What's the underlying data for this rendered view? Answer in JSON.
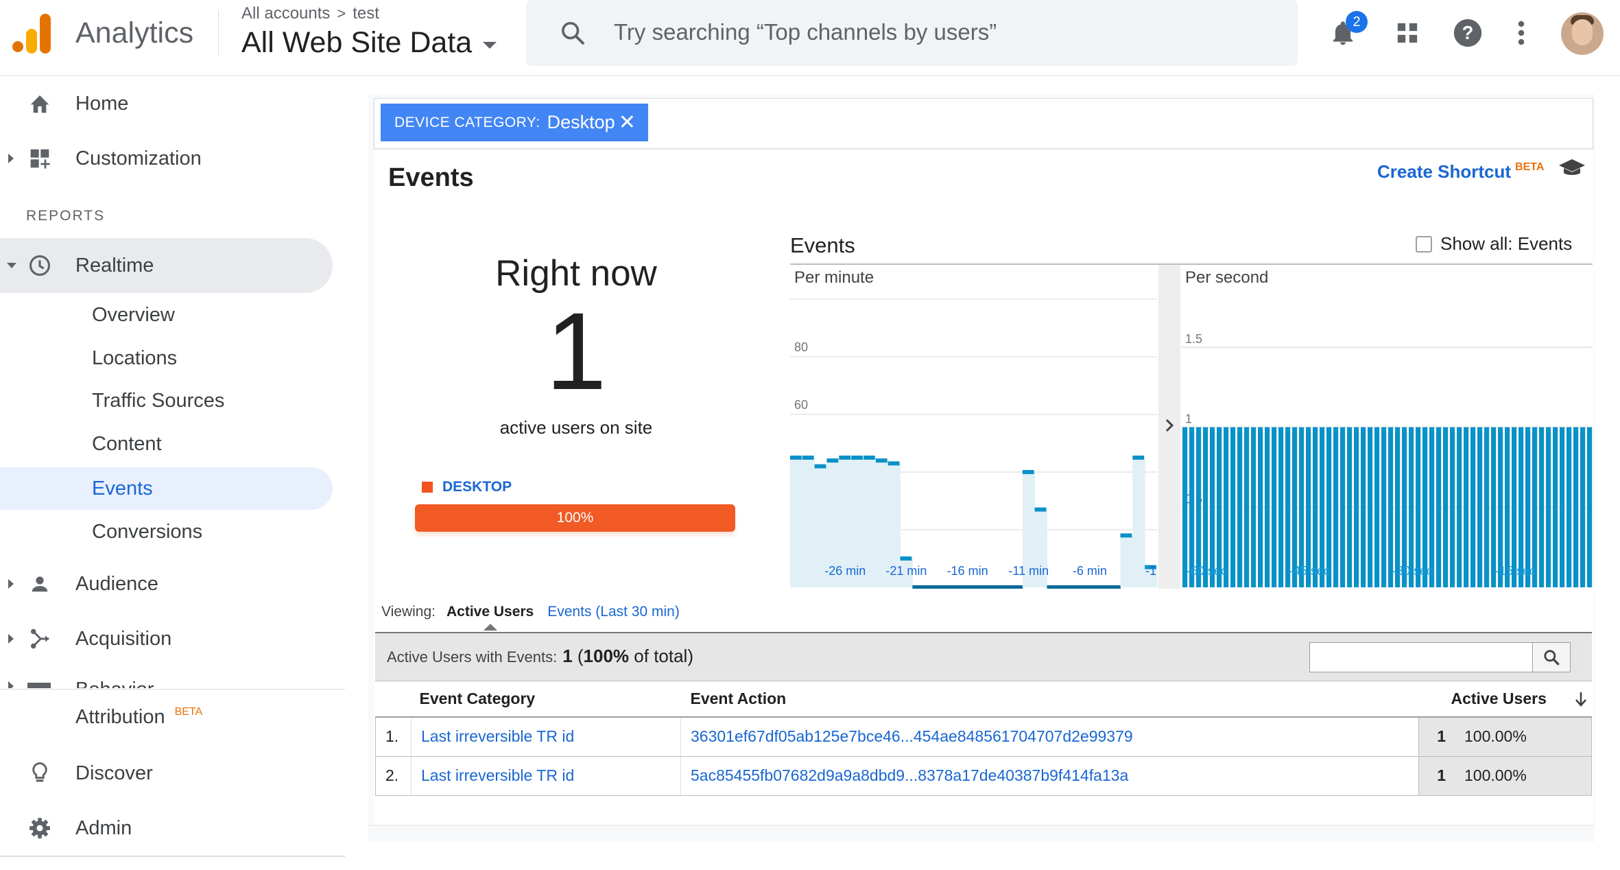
{
  "header": {
    "app_name": "Analytics",
    "breadcrumb": {
      "account": "All accounts",
      "separator": ">",
      "property": "test"
    },
    "view_name": "All Web Site Data",
    "search_placeholder": "Try searching “Top channels by users”",
    "notification_count": "2",
    "icons": [
      "search-icon",
      "bell-icon",
      "apps-grid-icon",
      "help-icon",
      "more-vert-icon",
      "avatar"
    ]
  },
  "sidebar": {
    "home": "Home",
    "customization": "Customization",
    "reports_heading": "REPORTS",
    "realtime": "Realtime",
    "realtime_items": [
      "Overview",
      "Locations",
      "Traffic Sources",
      "Content",
      "Events",
      "Conversions"
    ],
    "audience": "Audience",
    "acquisition": "Acquisition",
    "behavior": "Behavior",
    "attribution": "Attribution",
    "attribution_badge": "BETA",
    "discover": "Discover",
    "admin": "Admin",
    "selected": "Events"
  },
  "filter": {
    "key": "DEVICE CATEGORY:",
    "value": "Desktop",
    "remove": "✕"
  },
  "page": {
    "title": "Events",
    "create_shortcut": "Create Shortcut",
    "shortcut_badge": "BETA"
  },
  "right_now": {
    "label": "Right now",
    "value": "1",
    "sub": "active users on site",
    "device_label": "DESKTOP",
    "device_pct": "100%",
    "device_fraction": 1.0,
    "colors": {
      "device": "#f15a24"
    }
  },
  "events_panel": {
    "title": "Events",
    "show_all_label": "Show all: Events",
    "show_all_checked": false
  },
  "chart_data": [
    {
      "type": "bar",
      "title": "Per minute",
      "ylim": [
        0,
        100
      ],
      "yticks": [
        20,
        40,
        60,
        80
      ],
      "xticks": [
        "-26 min",
        "-21 min",
        "-16 min",
        "-11 min",
        "-6 min",
        "-1"
      ],
      "x": [
        -30,
        -29,
        -28,
        -27,
        -26,
        -25,
        -24,
        -23,
        -22,
        -21,
        -20,
        -19,
        -18,
        -17,
        -16,
        -15,
        -14,
        -13,
        -12,
        -11,
        -10,
        -9,
        -8,
        -7,
        -6,
        -5,
        -4,
        -3,
        -2,
        -1
      ],
      "values": [
        45,
        45,
        42,
        44,
        45,
        45,
        45,
        44,
        43,
        10,
        0,
        0,
        0,
        0,
        0,
        0,
        0,
        0,
        0,
        40,
        27,
        0,
        0,
        0,
        0,
        0,
        0,
        18,
        45,
        7
      ],
      "color": "#0a91c8",
      "fill": "#e1f0f7"
    },
    {
      "type": "bar",
      "title": "Per second",
      "ylim": [
        0,
        1.5
      ],
      "yticks": [
        0.5,
        1,
        1.5
      ],
      "xticks": [
        "-60 sec",
        "-45 sec",
        "-30 sec",
        "-15 sec"
      ],
      "values": [
        1,
        1,
        1,
        1,
        1,
        1,
        1,
        1,
        1,
        1,
        1,
        1,
        1,
        1,
        1,
        1,
        1,
        1,
        1,
        1,
        1,
        1,
        1,
        1,
        1,
        1,
        1,
        1,
        1,
        1,
        1,
        1,
        1,
        1,
        1,
        1,
        1,
        1,
        1,
        1,
        1,
        1,
        1,
        1,
        1,
        1,
        1,
        1,
        1,
        1,
        1,
        1,
        1,
        1,
        1,
        1,
        1,
        1,
        1,
        1
      ],
      "color": "#0a91c8"
    }
  ],
  "viewing": {
    "label": "Viewing:",
    "active_tab": "Active Users",
    "other_tab": "Events (Last 30 min)"
  },
  "summary": {
    "label": "Active Users with Events:",
    "value": "1",
    "pct": "100%",
    "suffix": "of total)"
  },
  "table": {
    "columns": [
      "Event Category",
      "Event Action",
      "Active Users"
    ],
    "sort_icon": "arrow-down-icon",
    "rows": [
      {
        "n": "1.",
        "category": "Last irreversible TR id",
        "action": "36301ef67df05ab125e7bce46...454ae848561704707d2e99379",
        "users": "1",
        "pct": "100.00%"
      },
      {
        "n": "2.",
        "category": "Last irreversible TR id",
        "action": "5ac85455fb07682d9a9a8dbd9...8378a17de40387b9f414fa13a",
        "users": "1",
        "pct": "100.00%"
      }
    ]
  }
}
